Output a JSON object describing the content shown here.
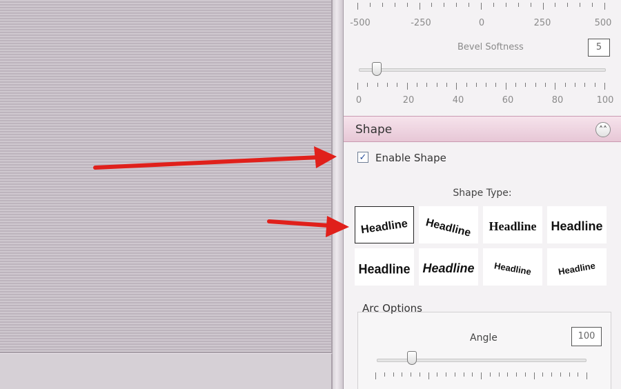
{
  "bevel": {
    "top_scale_labels": [
      "-500",
      "-250",
      "0",
      "250",
      "500"
    ],
    "softness_label": "Bevel Softness",
    "softness_value": "5",
    "softness_fraction": 0.05,
    "softness_scale_labels": [
      "0",
      "20",
      "40",
      "60",
      "80",
      "100"
    ]
  },
  "shape": {
    "title": "Shape",
    "collapse_icon": "double-chevron-up-icon",
    "enable_checked": true,
    "enable_label": "Enable Shape",
    "type_label": "Shape Type:",
    "tiles": [
      {
        "text": "Headline",
        "style": "arc-up",
        "selected": true
      },
      {
        "text": "Headline",
        "style": "rise",
        "selected": false
      },
      {
        "text": "Headline",
        "style": "flat-serif",
        "selected": false
      },
      {
        "text": "Headline",
        "style": "flat-bold",
        "selected": false
      },
      {
        "text": "Headline",
        "style": "bulge",
        "selected": false
      },
      {
        "text": "Headline",
        "style": "italic",
        "selected": false
      },
      {
        "text": "Headline",
        "style": "wave-down",
        "selected": false
      },
      {
        "text": "Headline",
        "style": "wave-up",
        "selected": false
      }
    ]
  },
  "arc_options": {
    "label": "Arc Options",
    "angle_label": "Angle",
    "angle_value": "100"
  },
  "colors": {
    "arrow": "#e0201b",
    "header": "#e7c7d6"
  }
}
